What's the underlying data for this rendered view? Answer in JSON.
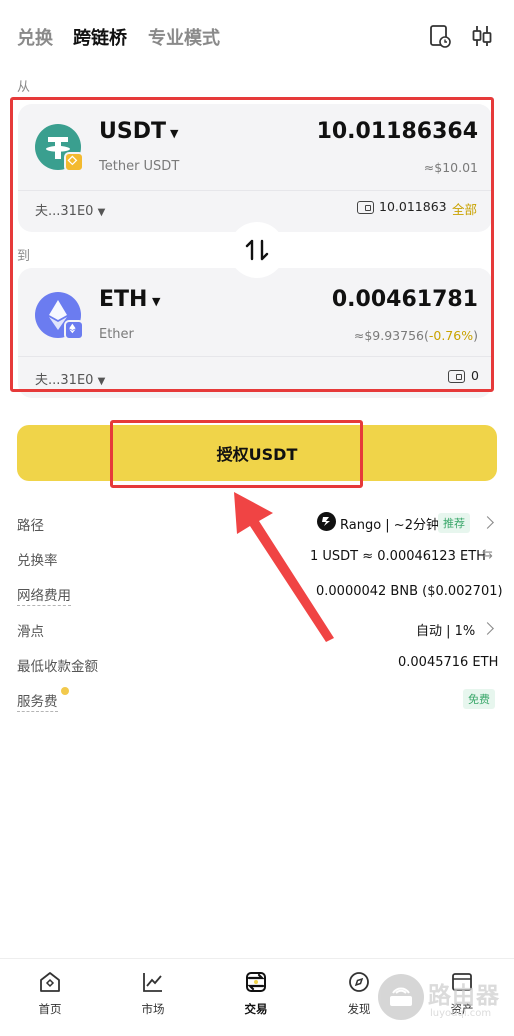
{
  "tabs": [
    {
      "label": "兑换",
      "active": false
    },
    {
      "label": "跨链桥",
      "active": true
    },
    {
      "label": "专业模式",
      "active": false
    }
  ],
  "header_icons": [
    "history-icon",
    "settings-icon"
  ],
  "from": {
    "section_label": "从",
    "symbol": "USDT",
    "name": "Tether USDT",
    "amount": "10.01186364",
    "usd": "≈$10.01",
    "chain": "夫...31E0",
    "balance": "10.011863",
    "max_label": "全部"
  },
  "to": {
    "section_label": "到",
    "symbol": "ETH",
    "name": "Ether",
    "amount": "0.00461781",
    "usd": "≈$9.93756(",
    "usd_change": "-0.76%",
    "usd_close": ")",
    "chain": "夫...31E0",
    "balance": "0"
  },
  "action_button": "授权USDT",
  "details": {
    "route": {
      "label": "路径",
      "value": "Rango | ~2分钟",
      "tag": "推荐"
    },
    "rate": {
      "label": "兑换率",
      "value": "1 USDT ≈ 0.00046123 ETH"
    },
    "network_fee": {
      "label": "网络费用",
      "value": "0.0000042 BNB ($0.002701)"
    },
    "slippage": {
      "label": "滑点",
      "value": "自动 | 1%"
    },
    "min_received": {
      "label": "最低收款金额",
      "value": "0.0045716 ETH"
    },
    "service_fee": {
      "label": "服务费",
      "tag": "免费"
    }
  },
  "nav": [
    {
      "label": "首页",
      "icon": "home-icon"
    },
    {
      "label": "市场",
      "icon": "market-chart-icon"
    },
    {
      "label": "交易",
      "icon": "trade-icon",
      "active": true
    },
    {
      "label": "发现",
      "icon": "discover-icon"
    },
    {
      "label": "资产",
      "icon": "assets-icon"
    }
  ],
  "watermark": {
    "text": "路由器",
    "sub": "luyouqi.com"
  },
  "colors": {
    "accent": "#f0d449",
    "highlight": "#e63a3a",
    "positive": "#3aa76a",
    "usdt": "#3a9f8f",
    "eth": "#6b7cf0"
  }
}
